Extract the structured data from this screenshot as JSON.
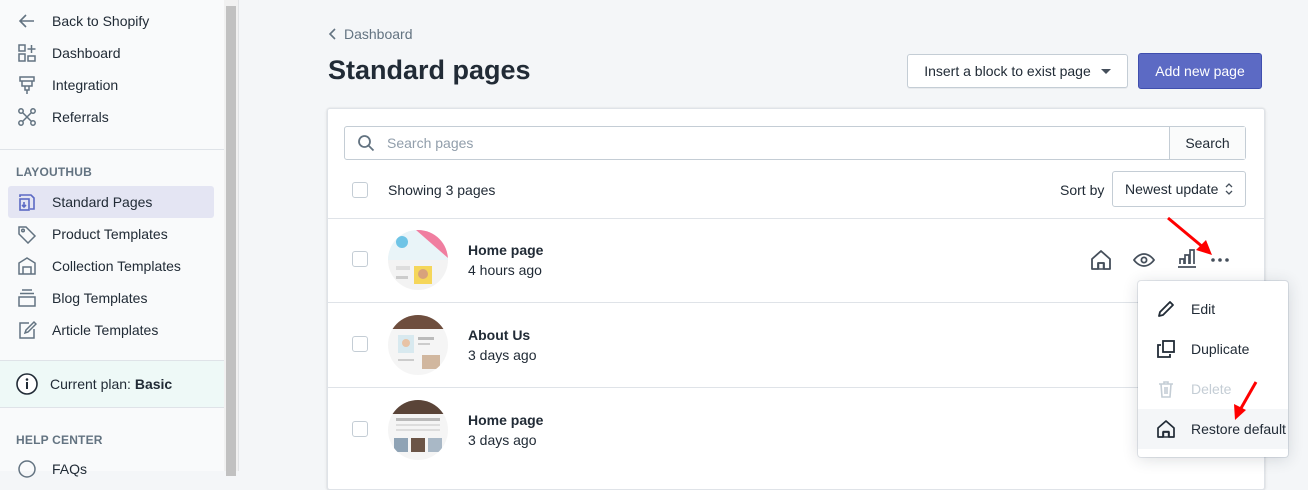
{
  "sidebar": {
    "items": [
      {
        "label": "Back to Shopify",
        "icon": "arrow-left-icon"
      },
      {
        "label": "Dashboard",
        "icon": "dashboard-icon"
      },
      {
        "label": "Integration",
        "icon": "integration-icon"
      },
      {
        "label": "Referrals",
        "icon": "referrals-icon"
      }
    ],
    "section_layouthub": "LAYOUTHUB",
    "layout_items": [
      {
        "label": "Standard Pages",
        "icon": "standard-pages-icon",
        "active": true
      },
      {
        "label": "Product Templates",
        "icon": "tag-icon"
      },
      {
        "label": "Collection Templates",
        "icon": "collection-icon"
      },
      {
        "label": "Blog Templates",
        "icon": "blog-icon"
      },
      {
        "label": "Article Templates",
        "icon": "article-icon"
      }
    ],
    "plan_label": "Current plan:",
    "plan_value": "Basic",
    "section_help": "HELP CENTER",
    "help_items": [
      {
        "label": "FAQs"
      }
    ]
  },
  "breadcrumb": "Dashboard",
  "page_title": "Standard pages",
  "actions": {
    "insert_block": "Insert a block to exist page",
    "add_new_page": "Add new page"
  },
  "search": {
    "placeholder": "Search pages",
    "button": "Search"
  },
  "list": {
    "showing": "Showing 3 pages",
    "sort_label": "Sort by",
    "sort_value": "Newest update",
    "rows": [
      {
        "title": "Home page",
        "updated": "4 hours ago"
      },
      {
        "title": "About Us",
        "updated": "3 days ago"
      },
      {
        "title": "Home page",
        "updated": "3 days ago"
      }
    ]
  },
  "menu": {
    "items": [
      {
        "label": "Edit",
        "icon": "pencil-icon"
      },
      {
        "label": "Duplicate",
        "icon": "duplicate-icon"
      },
      {
        "label": "Delete",
        "icon": "trash-icon",
        "disabled": true
      },
      {
        "label": "Restore default",
        "icon": "home-icon"
      }
    ]
  },
  "colors": {
    "primary": "#5c6ac4",
    "active_nav": "#e4e5f3",
    "annotation": "#ff0000"
  }
}
